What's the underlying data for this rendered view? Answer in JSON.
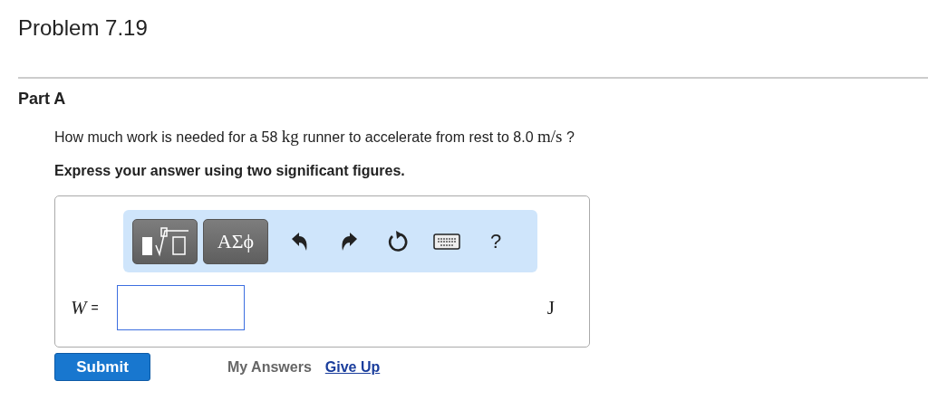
{
  "title": "Problem 7.19",
  "part": {
    "label": "Part A",
    "question": [
      {
        "kind": "text",
        "text": "How much work is needed for a 58 "
      },
      {
        "kind": "unit",
        "text": "kg"
      },
      {
        "kind": "text",
        "text": " runner to accelerate from rest to 8.0 "
      },
      {
        "kind": "unit",
        "text": "m/s"
      },
      {
        "kind": "text",
        "text": " ?"
      }
    ],
    "instruction": "Express your answer using two significant figures.",
    "toolbar": [
      {
        "kind": "templates"
      },
      {
        "kind": "symbols",
        "text": "ΑΣϕ"
      },
      {
        "kind": "undo"
      },
      {
        "kind": "redo"
      },
      {
        "kind": "reset"
      },
      {
        "kind": "keyboard"
      },
      {
        "kind": "help",
        "text": "?"
      }
    ],
    "answer": {
      "variable": "W",
      "equals": "=",
      "unit": "J"
    },
    "submit": "Submit",
    "my_answers": "My Answers",
    "give_up": "Give Up"
  }
}
